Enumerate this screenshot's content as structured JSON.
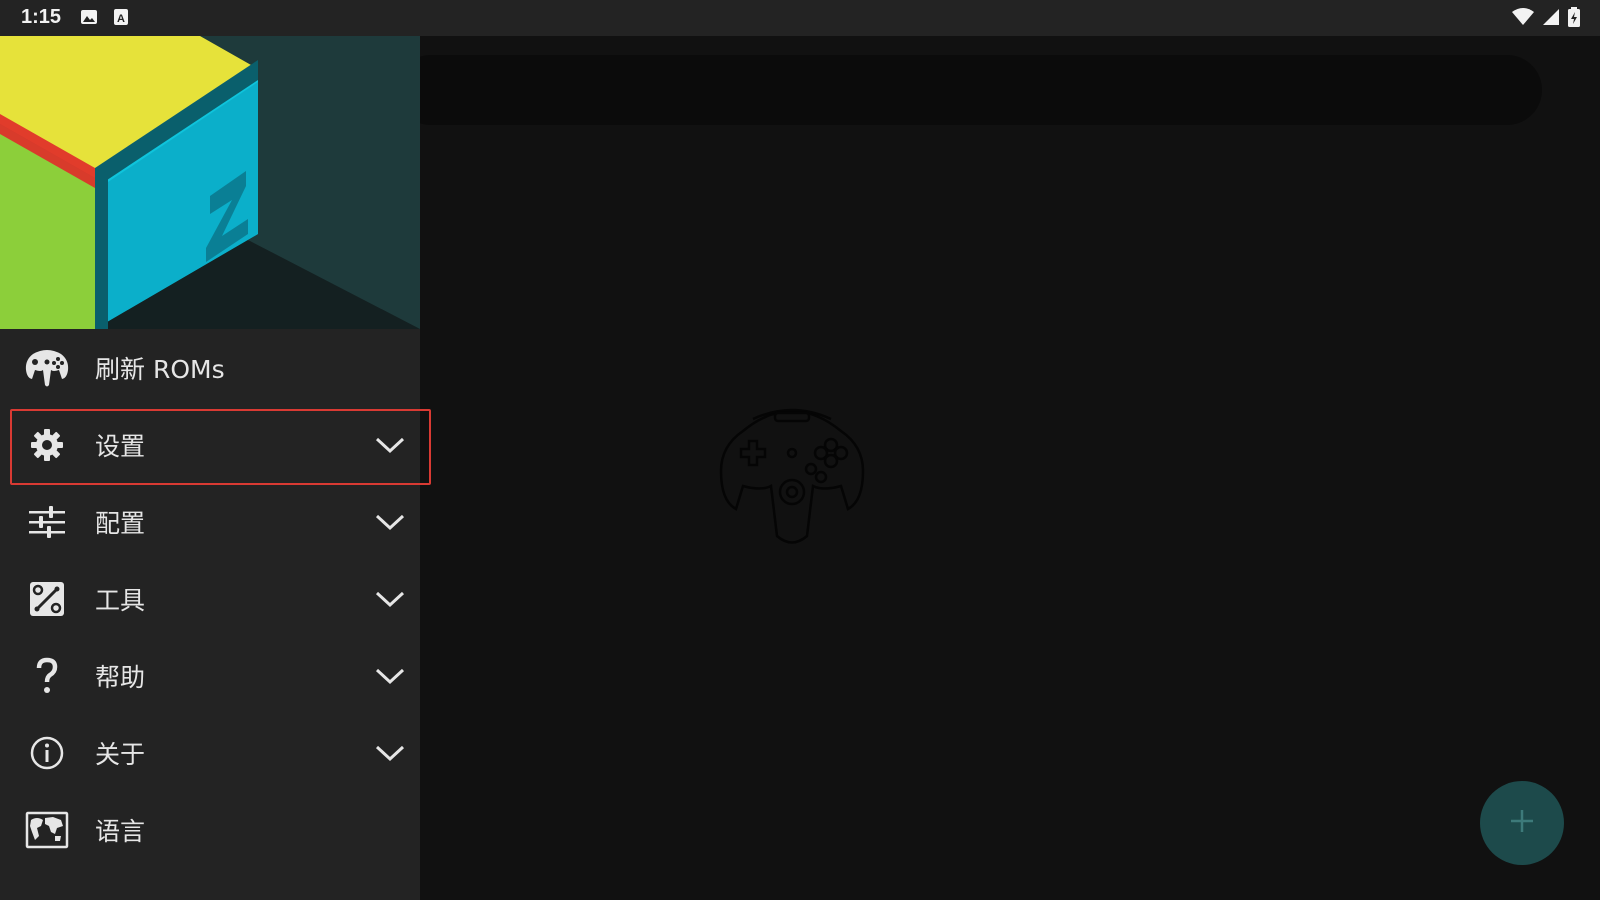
{
  "status_bar": {
    "time": "1:15",
    "icons": [
      "image-icon",
      "a-text-icon",
      "wifi-icon",
      "signal-icon",
      "battery-icon"
    ]
  },
  "drawer": {
    "header_logo": "z-cube-logo",
    "items": [
      {
        "label": "刷新 ROMs",
        "icon": "gamepad-icon",
        "expandable": false
      },
      {
        "label": "设置",
        "icon": "gear-icon",
        "expandable": true,
        "highlighted": true
      },
      {
        "label": "配置",
        "icon": "sliders-icon",
        "expandable": true
      },
      {
        "label": "工具",
        "icon": "tools-icon",
        "expandable": true
      },
      {
        "label": "帮助",
        "icon": "help-icon",
        "expandable": true
      },
      {
        "label": "关于",
        "icon": "info-icon",
        "expandable": true
      },
      {
        "label": "语言",
        "icon": "world-map-icon",
        "expandable": false
      }
    ]
  },
  "main": {
    "empty_state_icon": "n64-controller-icon",
    "fab_icon": "plus-icon"
  },
  "colors": {
    "status_bar": "#232323",
    "drawer_bg": "#232323",
    "main_bg": "#111111",
    "highlight_border": "#d93a33",
    "fab_bg": "#1d4a4b",
    "logo_yellow": "#e6e23a",
    "logo_cyan": "#0fd0e6",
    "logo_green": "#8ccf3a",
    "logo_red": "#e02a2a"
  }
}
